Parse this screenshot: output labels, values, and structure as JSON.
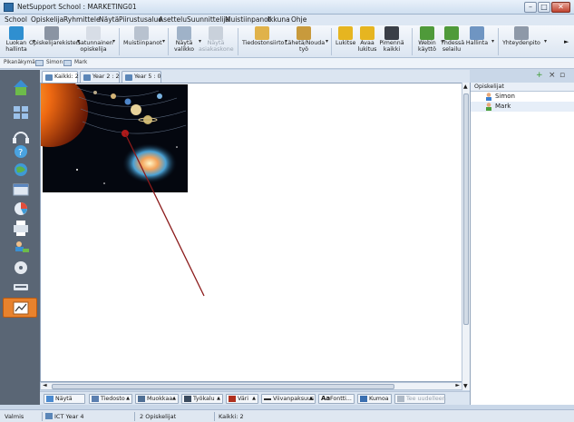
{
  "window": {
    "title": "NetSupport School : MARKETING01",
    "buttons": {
      "minimize": "–",
      "maximize": "□",
      "close": "✕"
    }
  },
  "menu": [
    "School",
    "Opiskelija",
    "Ryhmittele",
    "Näytä",
    "Piirustusalue",
    "Asettelu",
    "Suunnittelija",
    "Muistiinpanot",
    "Ikkuna",
    "Ohje"
  ],
  "toolbar": {
    "buttons": [
      {
        "label": "Luokan\nhallinta",
        "icon": "classroom-icon",
        "color": "#2f8fd0",
        "dropdown": true
      },
      {
        "label": "Opiskelijarekisteri",
        "icon": "register-icon",
        "color": "#8a94a3",
        "dropdown": true
      },
      {
        "label": "Satunnainen\nopiskelija",
        "icon": "dice-icon",
        "color": "#d7dde6",
        "dropdown": true
      },
      {
        "label": "Muistiinpanot",
        "icon": "notes-icon",
        "color": "#b8c2cf",
        "dropdown": true
      },
      {
        "label": "Näytä\nvalikko",
        "icon": "show-icon",
        "color": "#9fb2c8",
        "dropdown": true
      },
      {
        "label": "Näytä\nasiakaskone",
        "icon": "view-client-icon",
        "color": "#c9d1db",
        "dropdown": false,
        "disabled": true
      },
      {
        "label": "Tiedostonsiirto",
        "icon": "file-transfer-icon",
        "color": "#e0b24a",
        "dropdown": true
      },
      {
        "label": "Lähetä/Nouda\ntyö",
        "icon": "send-collect-icon",
        "color": "#c89a3c",
        "dropdown": true
      },
      {
        "label": "Lukitse",
        "icon": "lock-icon",
        "color": "#e6b520",
        "dropdown": false
      },
      {
        "label": "Avaa\nlukitus",
        "icon": "unlock-icon",
        "color": "#e6b520",
        "dropdown": false
      },
      {
        "label": "Pimennä\nkaikki",
        "icon": "blank-screen-icon",
        "color": "#3a3f47",
        "dropdown": false
      },
      {
        "label": "Webin\nkäyttö",
        "icon": "web-access-icon",
        "color": "#4f9a3a",
        "dropdown": true
      },
      {
        "label": "Yhdessä\nselailu",
        "icon": "co-browse-icon",
        "color": "#4f9a3a",
        "dropdown": false
      },
      {
        "label": "Hallinta",
        "icon": "manage-icon",
        "color": "#6f95c2",
        "dropdown": true
      },
      {
        "label": "Yhteydenpito",
        "icon": "communicate-icon",
        "color": "#8e99a8",
        "dropdown": true
      }
    ],
    "more": "►"
  },
  "quickbar": {
    "label": "Pikanäkymä:",
    "items": [
      "Simon",
      "Mark"
    ]
  },
  "tabs": [
    {
      "label": "Kaikki: 2",
      "active": true
    },
    {
      "label": "Year 2 : 2",
      "active": false
    },
    {
      "label": "Year 5 : 0",
      "active": false
    }
  ],
  "tab_actions": {
    "add": "+",
    "close": "×",
    "menu": "▫"
  },
  "sidebar_icons": [
    "home-icon",
    "thumbnails-icon",
    "audio-icon",
    "question-icon",
    "web-icon",
    "window-icon",
    "survey-icon",
    "print-icon",
    "student-list-icon",
    "media-icon",
    "devices-icon",
    "whiteboard-icon"
  ],
  "panel": {
    "title": "Opiskelijat",
    "students": [
      {
        "name": "Simon",
        "selected": false
      },
      {
        "name": "Mark",
        "selected": true
      }
    ]
  },
  "bottombar": [
    {
      "label": "Näytä",
      "icon": "show-icon",
      "dropdown": false
    },
    {
      "label": "Tiedosto",
      "icon": "file-icon",
      "dropdown": true
    },
    {
      "label": "Muokkaa",
      "icon": "edit-icon",
      "dropdown": true
    },
    {
      "label": "Työkalu",
      "icon": "tool-icon",
      "dropdown": true
    },
    {
      "label": "Väri",
      "icon": "color-icon",
      "dropdown": true
    },
    {
      "label": "Viivanpaksuus",
      "icon": "line-width-icon",
      "dropdown": true
    },
    {
      "label": "Fontti...",
      "icon": "font-icon",
      "dropdown": false
    },
    {
      "label": "Kumoa",
      "icon": "undo-icon",
      "dropdown": false
    },
    {
      "label": "Tee uudelleen",
      "icon": "redo-icon",
      "dropdown": false,
      "disabled": true
    }
  ],
  "status": {
    "ready": "Valmis",
    "group": "ICT Year 4",
    "students": "2 Opiskelijat",
    "all": "Kaikki: 2"
  },
  "scroll": {
    "left": "◄",
    "right": "►",
    "up": "▲",
    "down": "▼"
  },
  "colors": {
    "accent_orange": "#e8822d",
    "sidebar": "#5a6675",
    "pen_line": "#8b1a1a"
  }
}
